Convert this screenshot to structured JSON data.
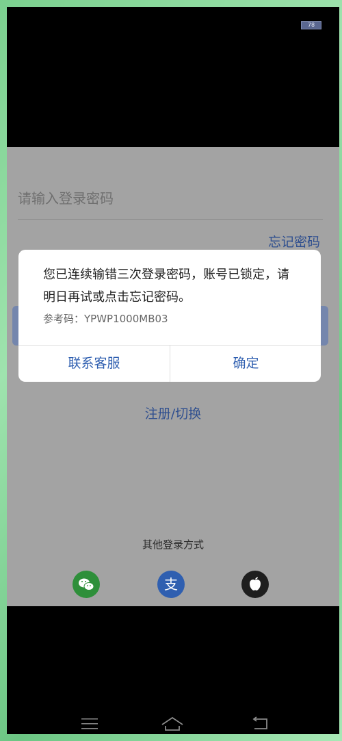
{
  "status_bar": {
    "battery_level": "78"
  },
  "login": {
    "password_placeholder": "请输入登录密码",
    "forgot_password_label": "忘记密码",
    "register_switch_label": "注册/切换",
    "other_login_title": "其他登录方式",
    "other_login_methods": [
      "wechat-icon",
      "alipay-icon",
      "apple-icon"
    ]
  },
  "dialog": {
    "message": "您已连续输错三次登录密码，账号已锁定，请明日再试或点击忘记密码。",
    "reference_label": "参考码：YPWP1000MB03",
    "contact_button_label": "联系客服",
    "confirm_button_label": "确定"
  },
  "navigation_bar": {
    "menu_icon": "menu-icon",
    "home_icon": "home-icon",
    "back_icon": "back-icon"
  },
  "colors": {
    "accent_blue": "#2f5fb0",
    "wechat_green": "#2e8f3a",
    "alipay_blue": "#2f5fb0"
  }
}
